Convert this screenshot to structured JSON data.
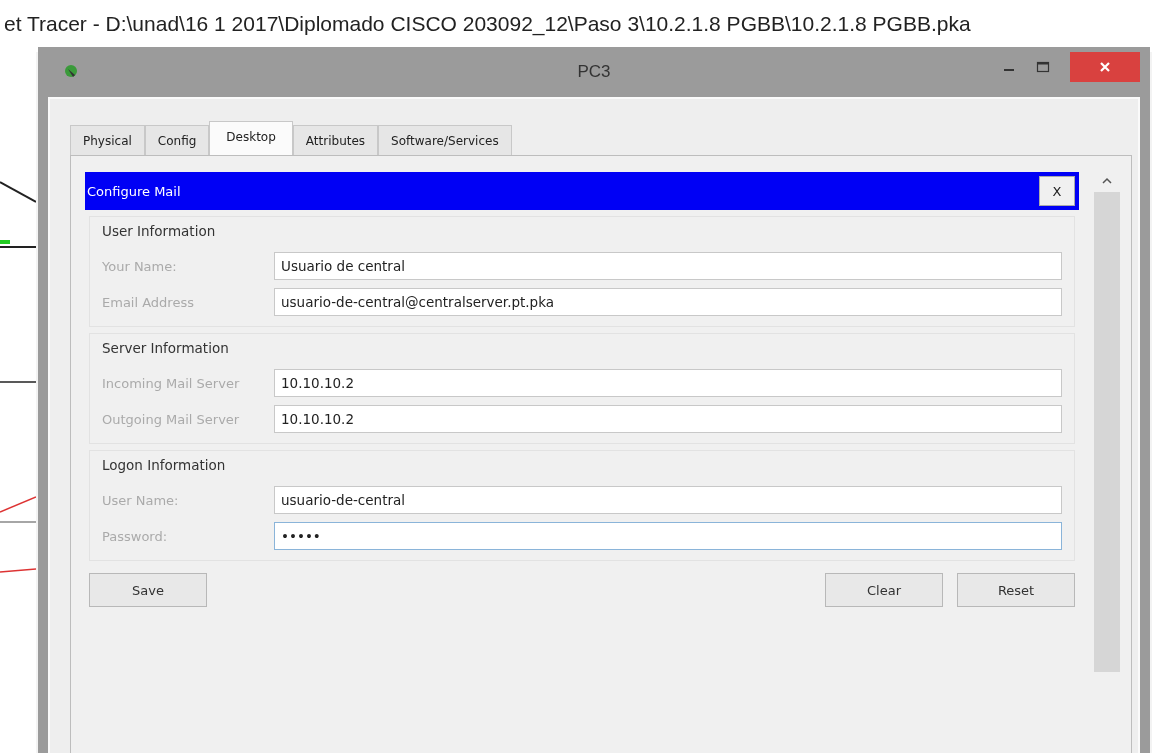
{
  "app_window": {
    "title": "et Tracer - D:\\unad\\16 1 2017\\Diplomado CISCO 203092_12\\Paso 3\\10.2.1.8 PGBB\\10.2.1.8 PGBB.pka"
  },
  "dialog": {
    "title": "PC3",
    "tabs": [
      {
        "label": "Physical",
        "selected": false
      },
      {
        "label": "Config",
        "selected": false
      },
      {
        "label": "Desktop",
        "selected": true
      },
      {
        "label": "Attributes",
        "selected": false
      },
      {
        "label": "Software/Services",
        "selected": false
      }
    ],
    "mail_panel": {
      "title": "Configure Mail",
      "close_label": "X",
      "sections": [
        {
          "title": "User Information",
          "fields": [
            {
              "label": "Your Name:",
              "value": "Usuario de central",
              "focused": false
            },
            {
              "label": "Email Address",
              "value": "usuario-de-central@centralserver.pt.pka",
              "focused": false
            }
          ]
        },
        {
          "title": "Server Information",
          "fields": [
            {
              "label": "Incoming Mail Server",
              "value": "10.10.10.2",
              "focused": false
            },
            {
              "label": "Outgoing Mail Server",
              "value": "10.10.10.2",
              "focused": false
            }
          ]
        },
        {
          "title": "Logon Information",
          "fields": [
            {
              "label": "User Name:",
              "value": "usuario-de-central",
              "focused": false
            },
            {
              "label": "Password:",
              "value": "•••••",
              "focused": true
            }
          ]
        }
      ],
      "left_buttons": [
        "Save"
      ],
      "right_buttons": [
        "Clear",
        "Reset"
      ]
    }
  }
}
